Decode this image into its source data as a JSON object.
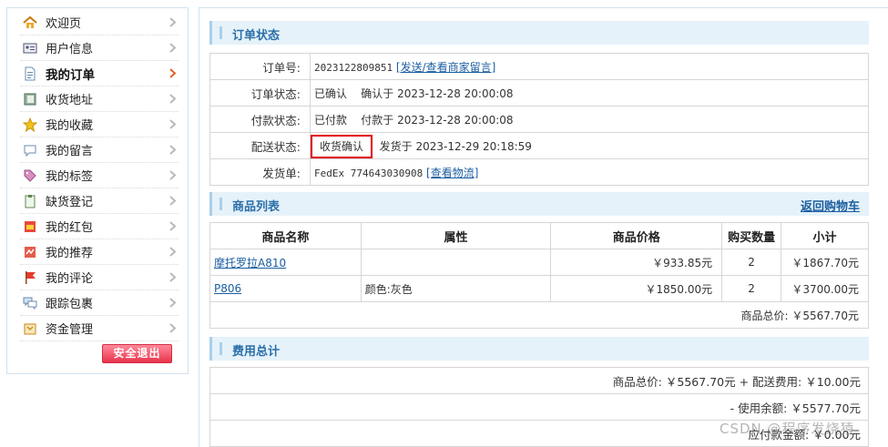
{
  "sidebar": {
    "items": [
      {
        "label": "欢迎页",
        "icon": "home-icon",
        "active": false
      },
      {
        "label": "用户信息",
        "icon": "id-card-icon",
        "active": false
      },
      {
        "label": "我的订单",
        "icon": "document-icon",
        "active": true
      },
      {
        "label": "收货地址",
        "icon": "address-book-icon",
        "active": false
      },
      {
        "label": "我的收藏",
        "icon": "star-icon",
        "active": false
      },
      {
        "label": "我的留言",
        "icon": "speech-bubble-icon",
        "active": false
      },
      {
        "label": "我的标签",
        "icon": "tag-icon",
        "active": false
      },
      {
        "label": "缺货登记",
        "icon": "clipboard-icon",
        "active": false
      },
      {
        "label": "我的红包",
        "icon": "red-envelope-icon",
        "active": false
      },
      {
        "label": "我的推荐",
        "icon": "recommend-icon",
        "active": false
      },
      {
        "label": "我的评论",
        "icon": "flag-icon",
        "active": false
      },
      {
        "label": "跟踪包裹",
        "icon": "chat-bubbles-icon",
        "active": false
      },
      {
        "label": "资金管理",
        "icon": "wallet-icon",
        "active": false
      }
    ],
    "logout_label": "安全退出"
  },
  "order_status": {
    "title": "订单状态",
    "order_no_label": "订单号:",
    "order_no": "2023122809851",
    "order_no_link": "[发送/查看商家留言]",
    "status_label": "订单状态:",
    "status_value": "已确认",
    "status_time": "确认于 2023-12-28 20:00:08",
    "pay_label": "付款状态:",
    "pay_value": "已付款",
    "pay_time": "付款于 2023-12-28 20:00:08",
    "ship_label": "配送状态:",
    "ship_value": "收货确认",
    "ship_time": "发货于 2023-12-29 20:18:59",
    "invoice_label": "发货单:",
    "invoice_value": "FedEx 774643030908",
    "invoice_link": "[查看物流]"
  },
  "goods": {
    "title": "商品列表",
    "back_link": "返回购物车",
    "headers": [
      "商品名称",
      "属性",
      "商品价格",
      "购买数量",
      "小计"
    ],
    "rows": [
      {
        "name": "摩托罗拉A810",
        "attr": "",
        "price": "￥933.85元",
        "qty": "2",
        "subtotal": "￥1867.70元"
      },
      {
        "name": "P806",
        "attr": "颜色:灰色",
        "price": "￥1850.00元",
        "qty": "2",
        "subtotal": "￥3700.00元"
      }
    ],
    "total": "商品总价: ￥5567.70元"
  },
  "fees": {
    "title": "费用总计",
    "line1": "商品总价: ￥5567.70元 + 配送费用: ￥10.00元",
    "line2": "- 使用余额: ￥5577.70元",
    "line3": "应付款金额: ￥0.00元"
  },
  "watermark": "CSDN @程序发烧猿",
  "colors": {
    "accent": "#2a6fa8",
    "highlight": "#e0000f",
    "logout": "#e8344c"
  }
}
